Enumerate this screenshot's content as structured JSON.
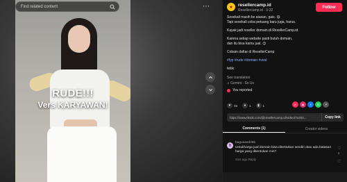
{
  "search": {
    "placeholder": "Find related content"
  },
  "video": {
    "overlay_title": "RUDE!!!",
    "overlay_subtitle": "Vers KARYAWAN!"
  },
  "author": {
    "name": "resellercamp.id",
    "sub": "Resellercamp.id · 3-22",
    "follow_label": "Follow"
  },
  "description": {
    "line1": "Sesekali masih ke atasan, gais. 😋",
    "line2": "Tapi sesekali coba petuang baru juga, harus.",
    "line3": "Kayak jadi reseller domain di ResellerCamp.id",
    "line4": "Karena setiap website pasti butuh domain,",
    "line5": "dan itu bisa kamu jual. 😉",
    "line6": "Cobain daftar di ResellerCamp",
    "hashtags": "#fyp #rude #domain #viral",
    "extra": "feliik",
    "see_translation": "See translation",
    "sound": "♫ Gemini - So Us",
    "reported": "You reported"
  },
  "actions": {
    "likes": "49",
    "comments": "1",
    "bookmarks": "1"
  },
  "share_icons": [
    {
      "name": "share-a",
      "color": "#fe2c55",
      "glyph": "▸"
    },
    {
      "name": "share-b",
      "color": "#e1306c",
      "glyph": "◉"
    },
    {
      "name": "share-c",
      "color": "#1877f2",
      "glyph": "f"
    },
    {
      "name": "share-d",
      "color": "#25d366",
      "glyph": "✆"
    },
    {
      "name": "share-e",
      "color": "#555555",
      "glyph": "↗"
    }
  ],
  "link": {
    "url": "https://www.tiktok.com/@resellercamp.id/video/7e203...",
    "copy_label": "Copy link"
  },
  "tabs": {
    "comments": "Comments (1)",
    "creator_videos": "Creator videos"
  },
  "comment": {
    "avatar_letter": "B",
    "user": "bagusandri65",
    "text": "Untukharga jual domain bisa ditentukan sendiri atau ada batasan harga yang ditentukan min?",
    "meta": "2ms ago    Reply",
    "likes": "0"
  }
}
